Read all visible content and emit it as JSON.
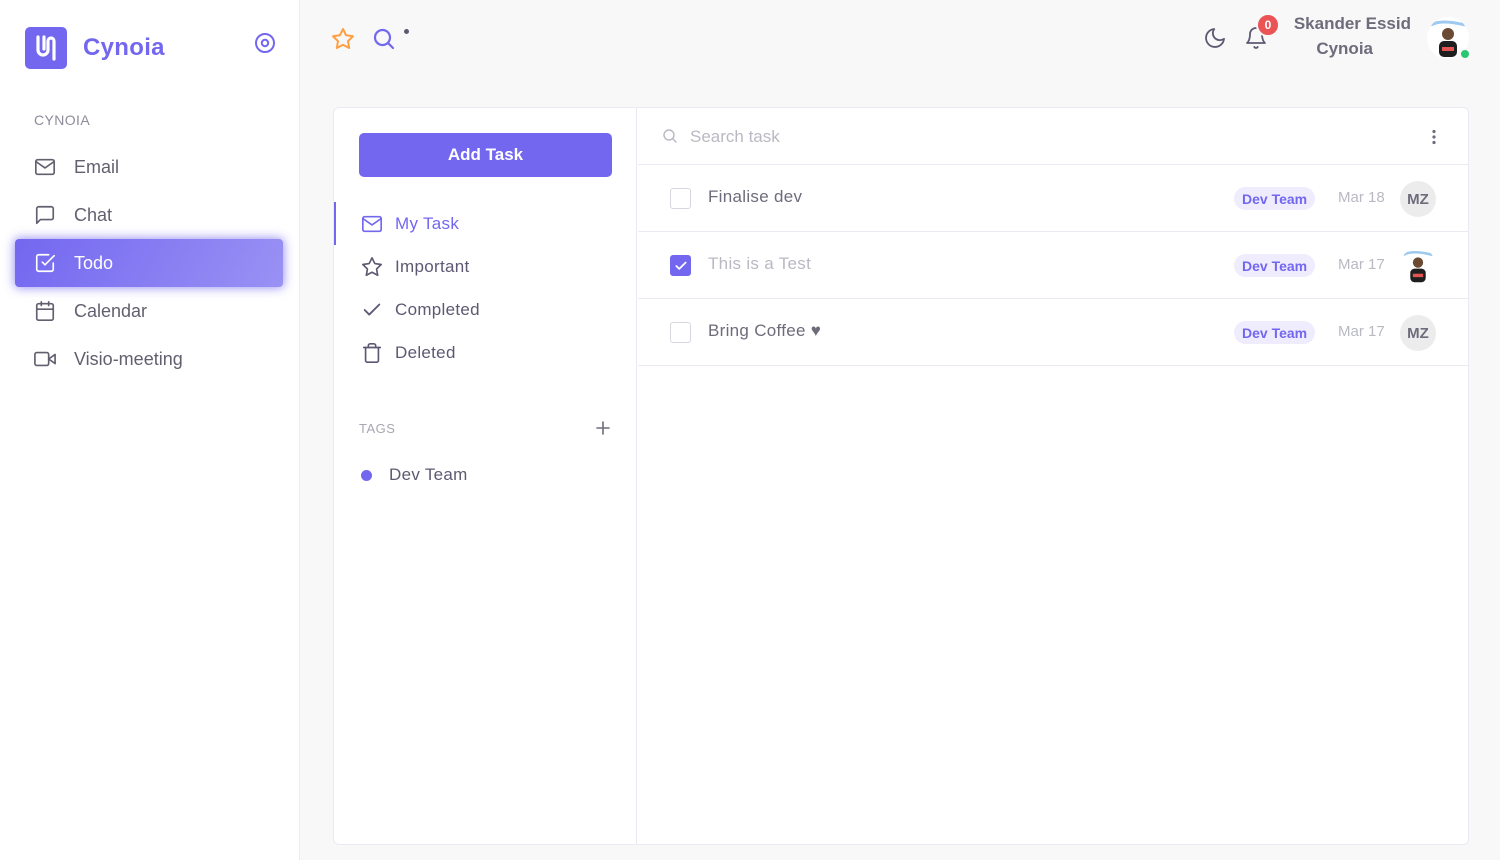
{
  "brand": {
    "name": "Cynoia"
  },
  "sidebar": {
    "section_label": "CYNOIA",
    "items": [
      {
        "label": "Email",
        "icon": "mail-icon",
        "active": false
      },
      {
        "label": "Chat",
        "icon": "message-square-icon",
        "active": false
      },
      {
        "label": "Todo",
        "icon": "check-square-icon",
        "active": true
      },
      {
        "label": "Calendar",
        "icon": "calendar-icon",
        "active": false
      },
      {
        "label": "Visio-meeting",
        "icon": "video-icon",
        "active": false
      }
    ]
  },
  "topbar": {
    "notification_count": "0",
    "user_name": "Skander Essid",
    "user_org": "Cynoia"
  },
  "todo": {
    "add_task_label": "Add Task",
    "filters": [
      {
        "label": "My Task",
        "icon": "mail-icon",
        "active": true
      },
      {
        "label": "Important",
        "icon": "star-icon",
        "active": false
      },
      {
        "label": "Completed",
        "icon": "check-icon",
        "active": false
      },
      {
        "label": "Deleted",
        "icon": "trash-icon",
        "active": false
      }
    ],
    "tags_heading": "TAGS",
    "tags": [
      {
        "label": "Dev Team",
        "color": "#7367f0"
      }
    ],
    "search_placeholder": "Search task",
    "tasks": [
      {
        "title": "Finalise dev",
        "completed": false,
        "tag": "Dev Team",
        "date": "Mar 18",
        "assignee": "MZ"
      },
      {
        "title": "This is a Test",
        "completed": true,
        "tag": "Dev Team",
        "date": "Mar 17",
        "assignee": ""
      },
      {
        "title": "Bring Coffee ♥",
        "completed": false,
        "tag": "Dev Team",
        "date": "Mar 17",
        "assignee": "MZ"
      }
    ]
  },
  "colors": {
    "primary": "#7367f0",
    "danger": "#ea5455",
    "success": "#28c76f",
    "star": "#ff9f43"
  }
}
